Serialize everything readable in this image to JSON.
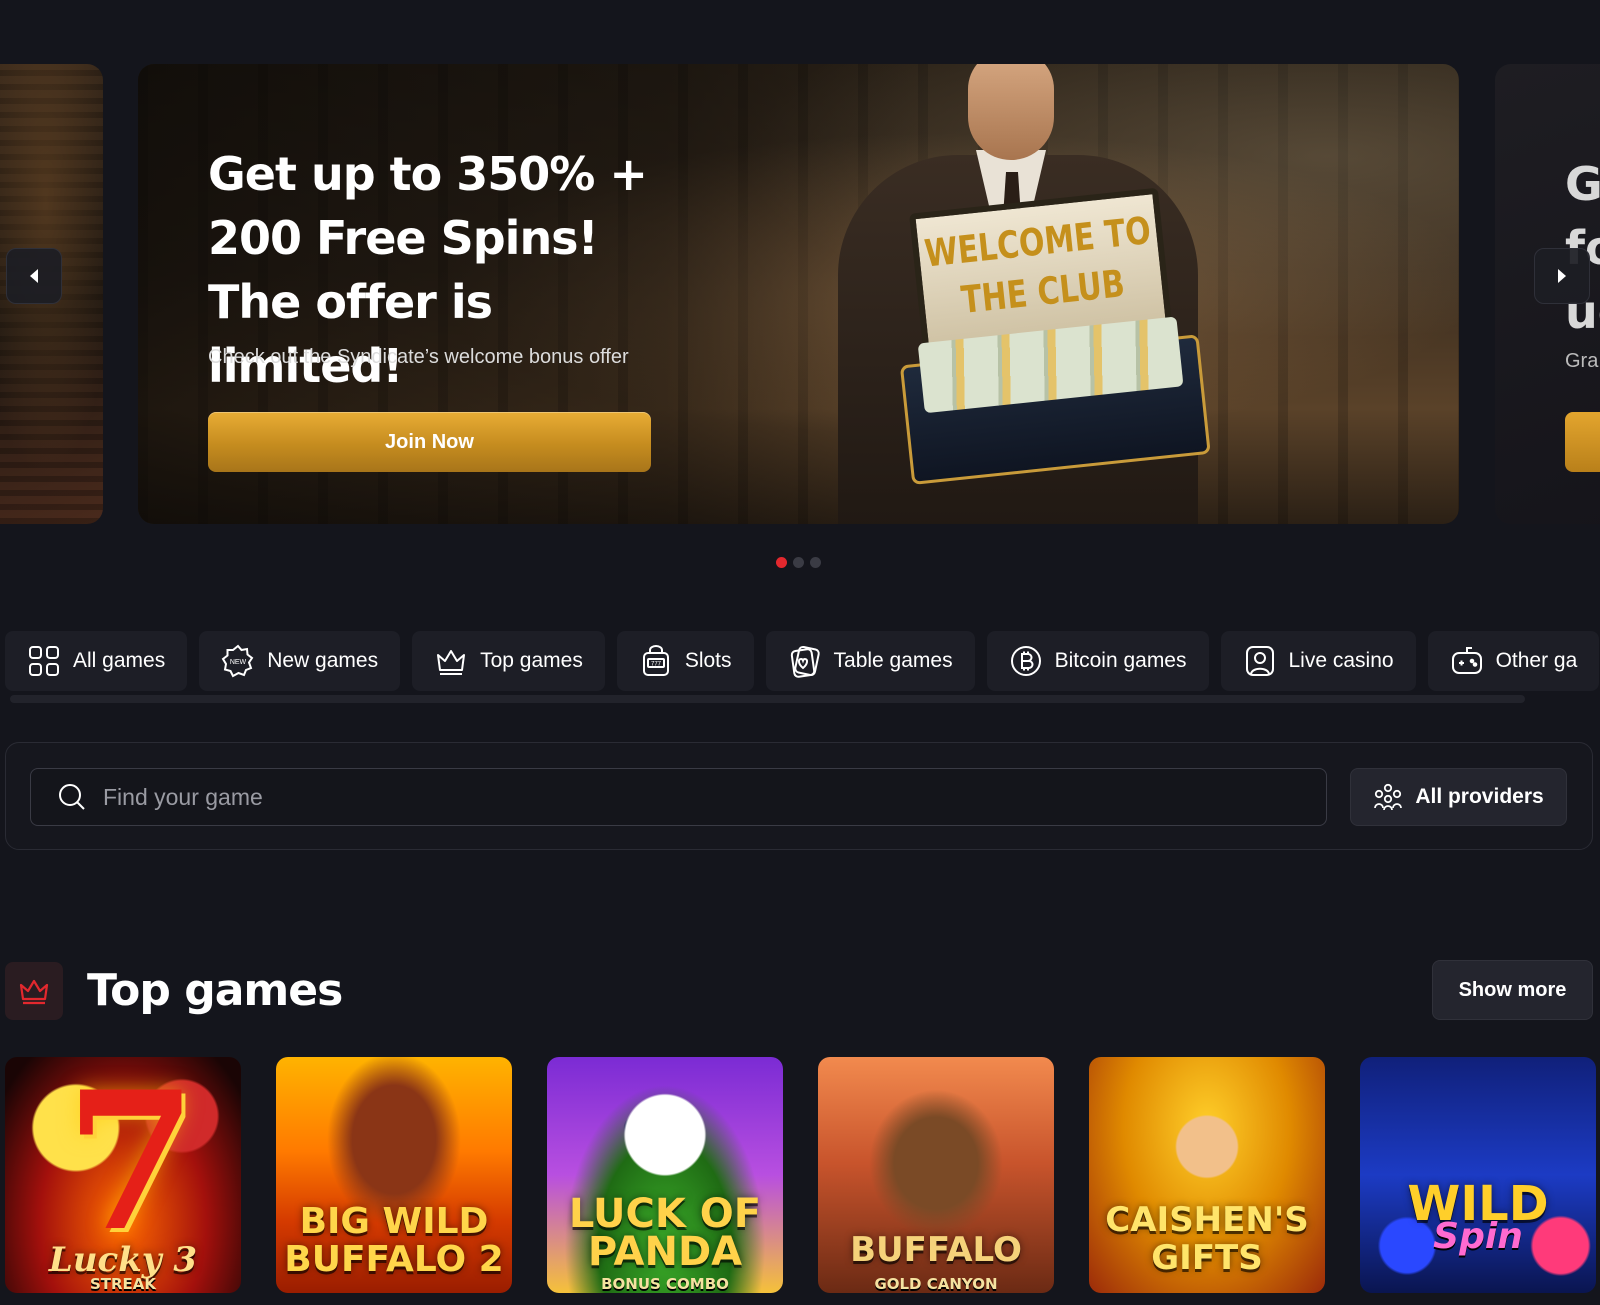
{
  "hero": {
    "title": "Get up to 350% + 200 Free Spins! The offer is limited!",
    "subtitle": "Check out the Syndicate’s welcome bonus offer",
    "cta_label": "Join Now",
    "case_text": "WELCOME TO THE CLUB",
    "next_slide_peek": {
      "title": "G\nfo\nue",
      "subtitle": "Gra"
    },
    "slide_count": 3,
    "active_slide": 1
  },
  "categories": [
    {
      "label": "All games",
      "icon": "grid-icon"
    },
    {
      "label": "New games",
      "icon": "new-badge-icon"
    },
    {
      "label": "Top games",
      "icon": "crown-icon"
    },
    {
      "label": "Slots",
      "icon": "slot-machine-icon"
    },
    {
      "label": "Table games",
      "icon": "card-heart-icon"
    },
    {
      "label": "Bitcoin games",
      "icon": "bitcoin-icon"
    },
    {
      "label": "Live casino",
      "icon": "user-portrait-icon"
    },
    {
      "label": "Other ga",
      "icon": "gamepad-icon"
    }
  ],
  "search": {
    "placeholder": "Find your game",
    "providers_label": "All providers"
  },
  "top_games": {
    "title": "Top games",
    "show_more_label": "Show more",
    "games": [
      {
        "title": "Lucky 3",
        "subtitle": "STREAK"
      },
      {
        "title": "BIG WILD BUFFALO 2",
        "subtitle": ""
      },
      {
        "title": "LUCK OF PANDA",
        "subtitle": "BONUS COMBO"
      },
      {
        "title": "BUFFALO",
        "subtitle": "GOLD CANYON"
      },
      {
        "title": "CAISHEN'S GIFTS",
        "subtitle": ""
      },
      {
        "title": "WILD",
        "subtitle": "Spin"
      }
    ]
  },
  "colors": {
    "background": "#14151c",
    "accent_red": "#e3282e",
    "cta_gold": "#e8ad35",
    "tab_bg": "#1d1e26"
  }
}
